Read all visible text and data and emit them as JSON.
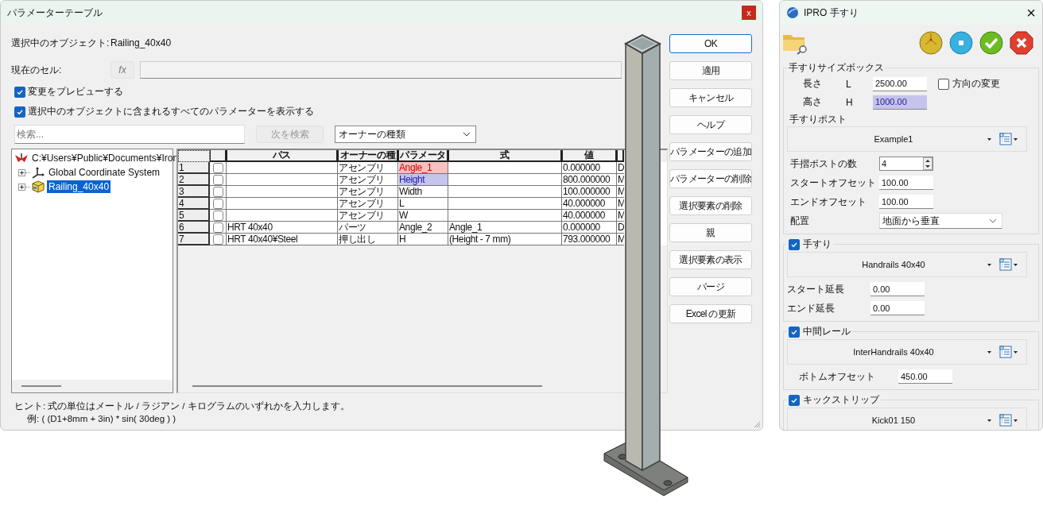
{
  "dialog": {
    "title": "パラメーターテーブル",
    "close": "x",
    "selected_object": {
      "label": "選択中のオブジェクト:",
      "value": "Railing_40x40"
    },
    "current_cell": {
      "label": "現在のセル:",
      "fx": "fx"
    },
    "options": [
      {
        "label": "変更をプレビューする",
        "checked": true
      },
      {
        "label": "選択中のオブジェクトに含まれるすべてのパラメーターを表示する",
        "checked": true
      }
    ],
    "search": {
      "placeholder": "検索...",
      "find_next": {
        "label": "次を検索",
        "disabled": true
      },
      "owner_filter": "オーナーの種類"
    },
    "tree": [
      {
        "label": "C:¥Users¥Public¥Documents¥Iron",
        "selected": false,
        "children": [
          {
            "label": "Global Coordinate System",
            "selected": false,
            "expanded": false
          },
          {
            "label": "Railing_40x40",
            "selected": true,
            "expanded": false
          }
        ]
      }
    ],
    "table": {
      "columns": [
        "パス",
        "オーナーの種",
        "パラメータ",
        "式",
        "値"
      ],
      "rows": [
        {
          "number": "1",
          "checked": false,
          "path": "",
          "owner": "アセンブリ",
          "parameter": "Angle_1",
          "color": "#f8c0c0",
          "formula": "",
          "value": "0.000000",
          "column_8": "D"
        },
        {
          "number": "2",
          "checked": false,
          "path": "",
          "owner": "アセンブリ",
          "parameter": "Height",
          "color": "#c4c4ee",
          "formula": "",
          "value": "800.000000",
          "column_8": "M"
        },
        {
          "number": "3",
          "checked": false,
          "path": "",
          "owner": "アセンブリ",
          "parameter": "Width",
          "formula": "",
          "value": "100.000000",
          "column_8": "M"
        },
        {
          "number": "4",
          "checked": false,
          "path": "",
          "owner": "アセンブリ",
          "parameter": "L",
          "formula": "",
          "value": "40.000000",
          "column_8": "M"
        },
        {
          "number": "5",
          "checked": false,
          "path": "",
          "owner": "アセンブリ",
          "parameter": "W",
          "formula": "",
          "value": "40.000000",
          "column_8": "M"
        },
        {
          "number": "6",
          "checked": false,
          "path": "HRT 40x40",
          "owner": "パーツ",
          "parameter": "Angle_2",
          "formula": "Angle_1",
          "value": "0.000000",
          "column_8": "D"
        },
        {
          "number": "7",
          "checked": false,
          "path": "HRT 40x40¥Steel",
          "owner": "押し出し",
          "parameter": "H",
          "formula": "(Height - 7 mm)",
          "value": "793.000000",
          "column_8": "M"
        }
      ]
    },
    "hint": [
      "ヒント: 式の単位はメートル / ラジアン / キログラムのいずれかを入力します。",
      "例: ( (D1+8mm + 3in) * sin( 30deg ) )"
    ],
    "buttons": [
      {
        "label": "OK",
        "default": true
      },
      {
        "label": "適用",
        "default": false
      },
      {
        "label": "キャンセル",
        "default": false
      },
      {
        "label": "ヘルプ",
        "default": false
      },
      {
        "label": "パラメーターの追加",
        "default": false
      },
      {
        "label": "パラメーターの削除",
        "default": false
      },
      {
        "label": "選択要素の削除",
        "default": false
      },
      {
        "label": "親",
        "default": false
      },
      {
        "label": "選択要素の表示",
        "default": false
      },
      {
        "label": "パージ",
        "default": false
      },
      {
        "label": "Excel の更新",
        "default": false
      }
    ]
  },
  "panel": {
    "title": "IPRO 手すり",
    "close": "×",
    "size_box": {
      "title": "手すりサイズボックス",
      "fields": [
        {
          "label": "長さ",
          "axis": "L",
          "value": "2500.00",
          "highlighted": false
        },
        {
          "label": "高さ",
          "axis": "H",
          "value": "1000.00",
          "highlighted": true
        }
      ],
      "flip": {
        "label": "方向の変更",
        "checked": false
      }
    },
    "post": {
      "title": "手すりポスト",
      "profile": "Example1",
      "fields": [
        {
          "kind": "spin",
          "label": "手摺ポストの数",
          "value": "4"
        },
        {
          "kind": "text",
          "label": "スタートオフセット",
          "value": "100.00"
        },
        {
          "kind": "text",
          "label": "エンドオフセット",
          "value": "100.00"
        },
        {
          "kind": "select",
          "label": "配置",
          "value": "地面から垂直"
        }
      ]
    },
    "sections": [
      {
        "title": "手すり",
        "checked": true,
        "profile": "Handrails 40x40",
        "fields": [
          {
            "label": "スタート延長",
            "value": "0.00"
          },
          {
            "label": "エンド延長",
            "value": "0.00"
          }
        ]
      },
      {
        "title": "中間レール",
        "checked": true,
        "profile": "InterHandrails 40x40",
        "fields": [
          {
            "label": "ボトムオフセット",
            "value": "450.00"
          }
        ],
        "indented": true
      },
      {
        "title": "キックストリップ",
        "checked": true,
        "profile": "Kick01 150"
      }
    ]
  }
}
